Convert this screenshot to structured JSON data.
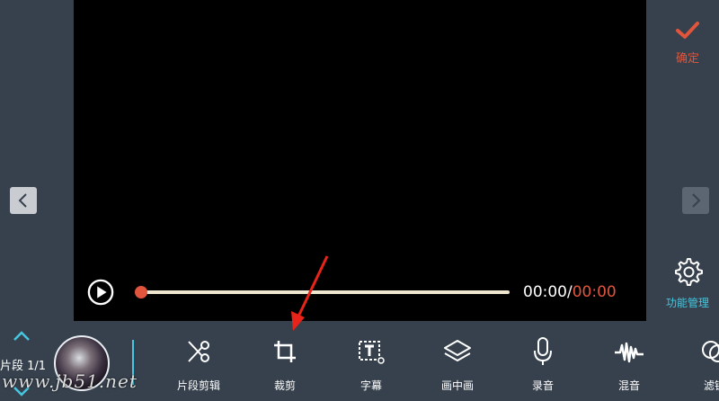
{
  "header": {
    "confirm_label": "确定",
    "function_manage_label": "功能管理"
  },
  "player": {
    "current_time": "00:00",
    "separator": "/",
    "duration": "00:00",
    "progress": 0
  },
  "timeline": {
    "segment_label": "片段 1/1"
  },
  "toolbar": {
    "tools": [
      {
        "label": "片段剪辑",
        "icon": "scissors-icon"
      },
      {
        "label": "裁剪",
        "icon": "crop-icon"
      },
      {
        "label": "字幕",
        "icon": "subtitle-icon"
      },
      {
        "label": "画中画",
        "icon": "layers-icon"
      },
      {
        "label": "录音",
        "icon": "microphone-icon"
      },
      {
        "label": "混音",
        "icon": "waveform-icon"
      },
      {
        "label": "滤镜",
        "icon": "filter-icon"
      }
    ]
  },
  "watermark": "www.jb51.net",
  "colors": {
    "accent_red": "#e0553c",
    "accent_cyan": "#47c7e0",
    "panel_bg": "#36414d"
  }
}
